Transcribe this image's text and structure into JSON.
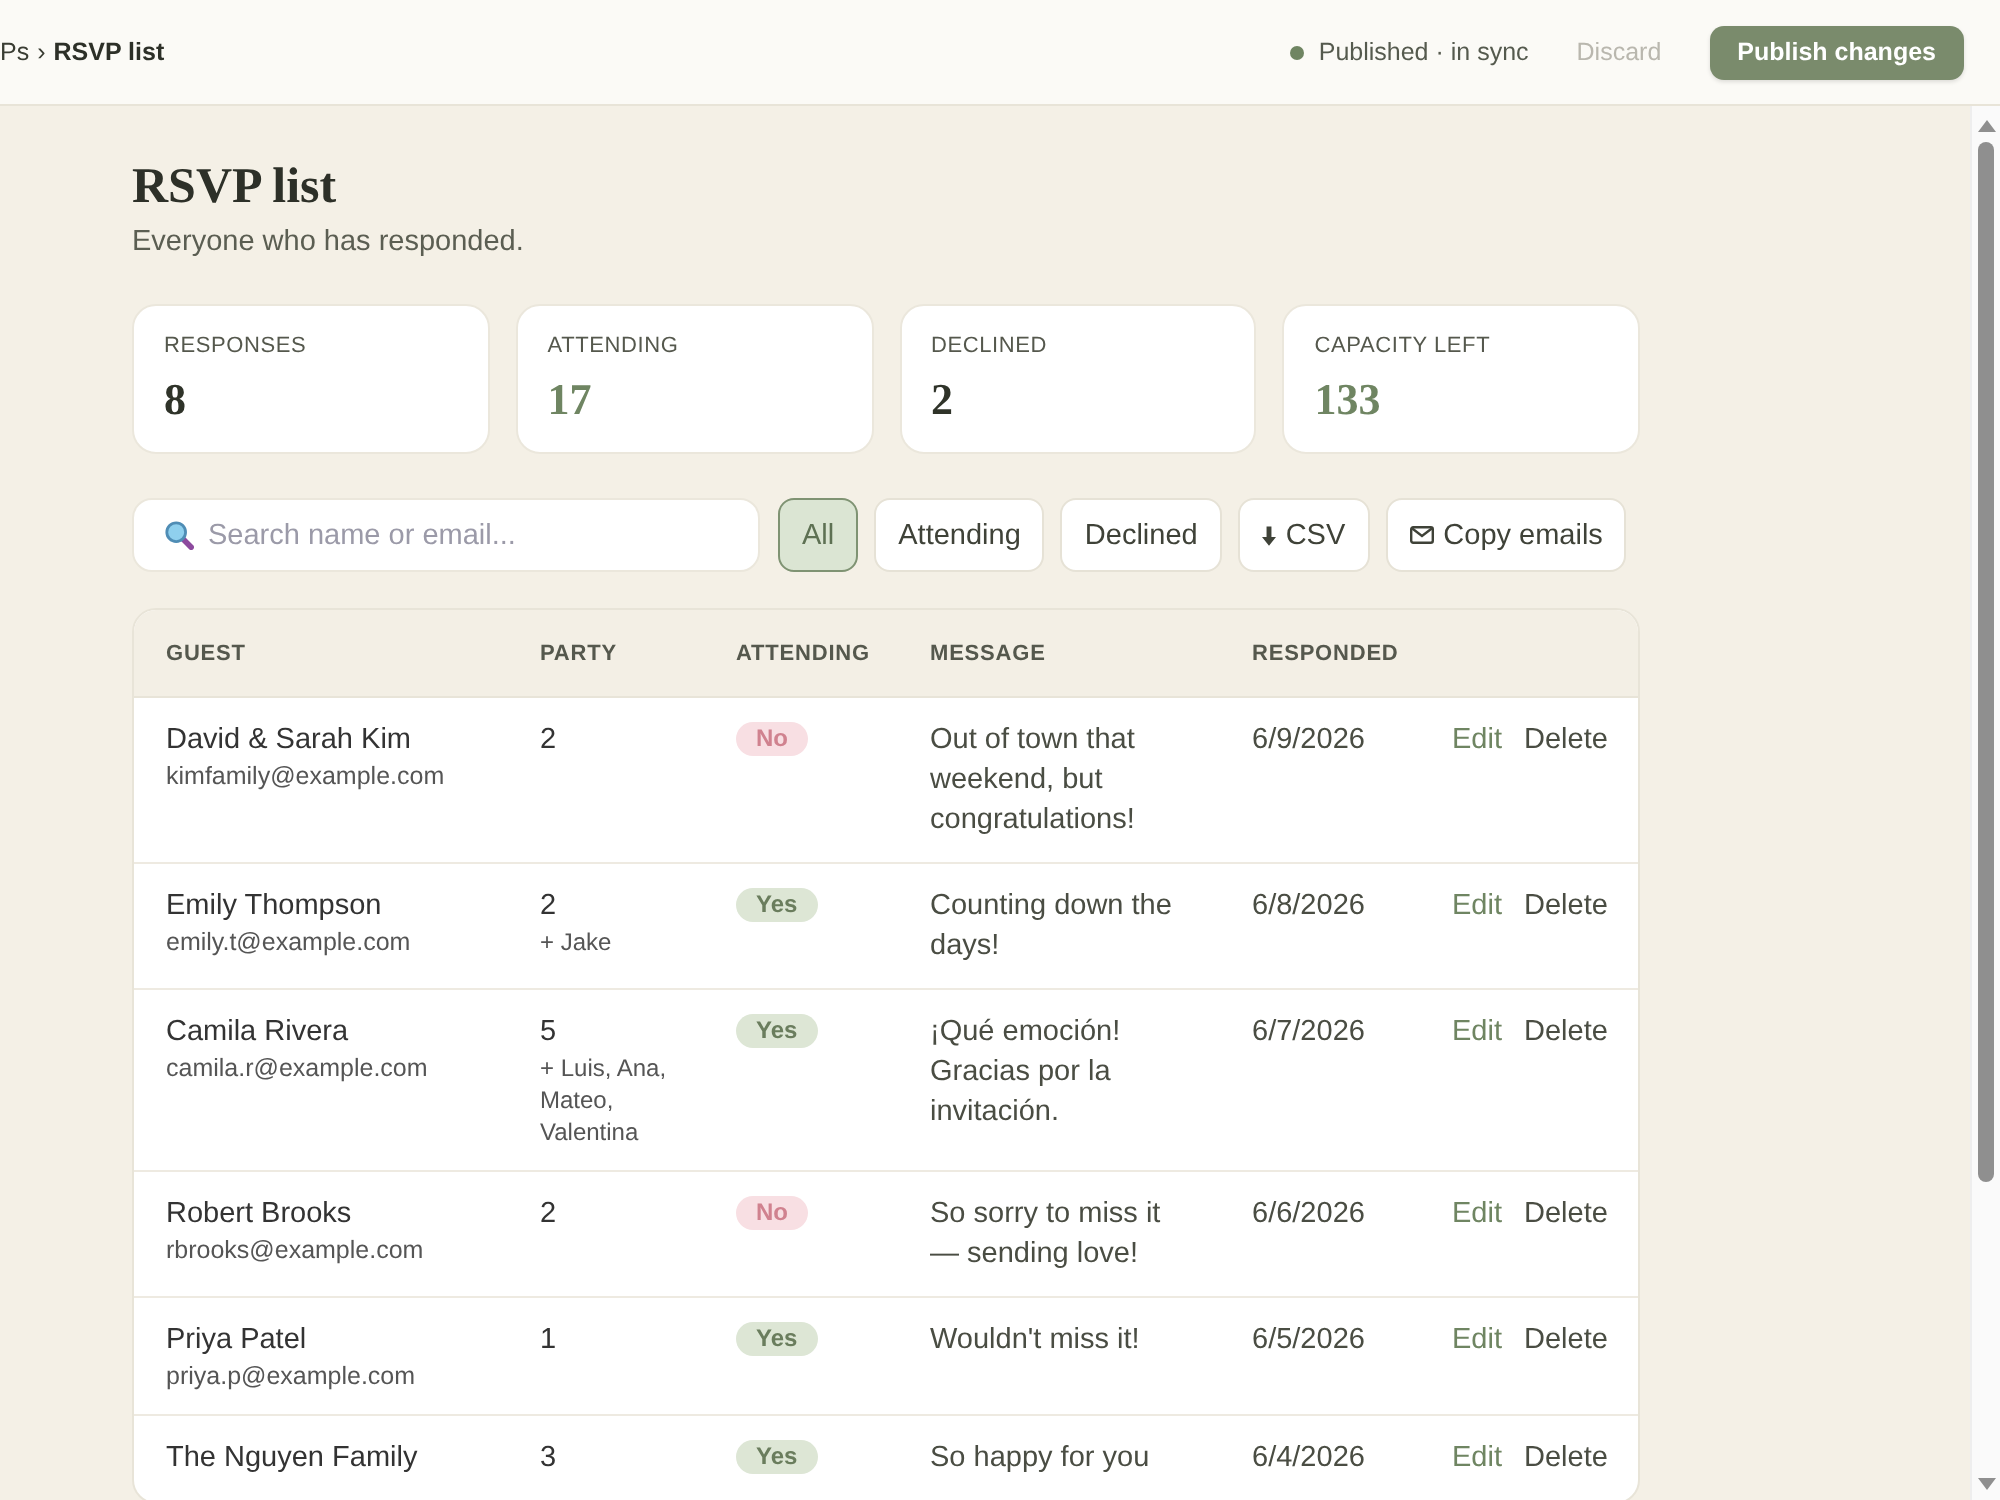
{
  "topbar": {
    "breadcrumb": [
      {
        "label": "Ps",
        "current": false
      },
      {
        "label": "RSVP list",
        "current": true
      }
    ],
    "separator": "›",
    "status": "Published · in sync",
    "actions": [
      {
        "label": "Discard",
        "kind": "link",
        "disabled": true
      },
      {
        "label": "Publish changes",
        "kind": "primary",
        "disabled": false
      }
    ]
  },
  "page": {
    "title": "RSVP list",
    "subtitle": "Everyone who has responded."
  },
  "stats": [
    {
      "label": "RESPONSES",
      "value": "8",
      "color": "#2f3329"
    },
    {
      "label": "ATTENDING",
      "value": "17",
      "color": "#6f8562"
    },
    {
      "label": "DECLINED",
      "value": "2",
      "color": "#2f3329"
    },
    {
      "label": "CAPACITY LEFT",
      "value": "133",
      "color": "#6f8562"
    }
  ],
  "search": {
    "placeholder": "Search name or email..."
  },
  "filters": [
    {
      "label": "All",
      "selected": true
    },
    {
      "label": "Attending",
      "selected": false
    },
    {
      "label": "Declined",
      "selected": false
    }
  ],
  "tools": [
    {
      "label": "CSV",
      "kind": "download"
    },
    {
      "label": "Copy emails",
      "kind": "email"
    }
  ],
  "table": {
    "columns": [
      "GUEST",
      "PARTY",
      "ATTENDING",
      "MESSAGE",
      "RESPONDED"
    ],
    "rows": [
      {
        "name": "David & Sarah Kim",
        "email": "kimfamily@example.com",
        "party": "2",
        "attending": false,
        "status": "No",
        "message": "Out of town that weekend, but congratulations!",
        "responded": "6/9/2026",
        "actions": [
          {
            "label": "Edit",
            "kind": "edit"
          },
          {
            "label": "Delete",
            "kind": "delete"
          }
        ]
      },
      {
        "name": "Emily Thompson",
        "email": "emily.t@example.com",
        "party": "2",
        "guests": "+ Jake",
        "attending": true,
        "status": "Yes",
        "message": "Counting down the days!",
        "responded": "6/8/2026",
        "actions": [
          {
            "label": "Edit",
            "kind": "edit"
          },
          {
            "label": "Delete",
            "kind": "delete"
          }
        ]
      },
      {
        "name": "Camila Rivera",
        "email": "camila.r@example.com",
        "party": "5",
        "guests": "+ Luis, Ana, Mateo, Valentina",
        "attending": true,
        "status": "Yes",
        "message": "¡Qué emoción! Gracias por la invitación.",
        "responded": "6/7/2026",
        "actions": [
          {
            "label": "Edit",
            "kind": "edit"
          },
          {
            "label": "Delete",
            "kind": "delete"
          }
        ]
      },
      {
        "name": "Robert Brooks",
        "email": "rbrooks@example.com",
        "party": "2",
        "attending": false,
        "status": "No",
        "message": "So sorry to miss it — sending love!",
        "responded": "6/6/2026",
        "actions": [
          {
            "label": "Edit",
            "kind": "edit"
          },
          {
            "label": "Delete",
            "kind": "delete"
          }
        ]
      },
      {
        "name": "Priya Patel",
        "email": "priya.p@example.com",
        "party": "1",
        "attending": true,
        "status": "Yes",
        "message": "Wouldn't miss it!",
        "responded": "6/5/2026",
        "actions": [
          {
            "label": "Edit",
            "kind": "edit"
          },
          {
            "label": "Delete",
            "kind": "delete"
          }
        ]
      },
      {
        "name": "The Nguyen Family",
        "party": "3",
        "attending": true,
        "status": "Yes",
        "message": "So happy for you",
        "responded": "6/4/2026",
        "actions": [
          {
            "label": "Edit",
            "kind": "edit"
          },
          {
            "label": "Delete",
            "kind": "delete"
          }
        ]
      }
    ]
  }
}
